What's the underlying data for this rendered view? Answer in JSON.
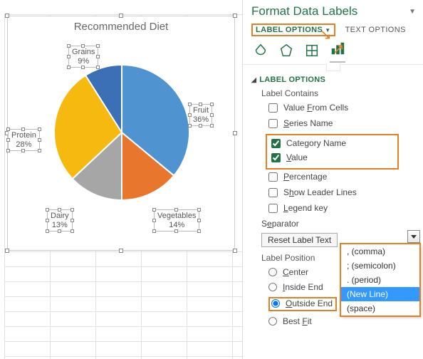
{
  "pane": {
    "title": "Format Data Labels",
    "tabs": {
      "label_options": "LABEL OPTIONS",
      "text_options": "TEXT OPTIONS"
    },
    "section": "LABEL OPTIONS",
    "label_contains": "Label Contains",
    "opts": {
      "from_cells": "Value From Cells",
      "series_name": "Series Name",
      "category_name": "Category Name",
      "value": "Value",
      "percentage": "Percentage",
      "leader_lines": "Show Leader Lines",
      "legend_key": "Legend key"
    },
    "separator_label": "Separator",
    "reset_button": "Reset Label Text",
    "label_position": "Label Position",
    "positions": {
      "center": "Center",
      "inside_end": "Inside End",
      "outside_end": "Outside End",
      "best_fit": "Best Fit"
    },
    "separator_options": [
      ", (comma)",
      "; (semicolon)",
      ". (period)",
      "(New Line)",
      "  (space)"
    ],
    "separator_selected": "(New Line)"
  },
  "chart_data": {
    "type": "pie",
    "title": "Recommended Diet",
    "series": [
      {
        "name": "Fruit",
        "value": 36,
        "label": "Fruit\n36%",
        "color": "#4f93d1"
      },
      {
        "name": "Vegetables",
        "value": 14,
        "label": "Vegetables\n14%",
        "color": "#e8762d"
      },
      {
        "name": "Dairy",
        "value": 13,
        "label": "Dairy\n13%",
        "color": "#a6a6a6"
      },
      {
        "name": "Protein",
        "value": 28,
        "label": "Protein\n28%",
        "color": "#f5b90f"
      },
      {
        "name": "Grains",
        "value": 9,
        "label": "Grains\n9%",
        "color": "#3b6fb6"
      }
    ]
  }
}
